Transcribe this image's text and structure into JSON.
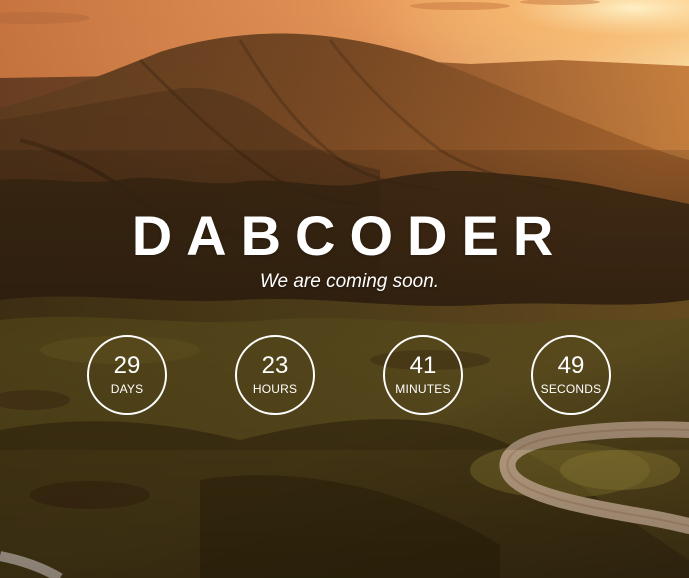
{
  "hero": {
    "brand": "DABCODER",
    "tagline": "We are coming soon."
  },
  "countdown": {
    "days": {
      "value": "29",
      "label": "DAYS"
    },
    "hours": {
      "value": "23",
      "label": "HOURS"
    },
    "minutes": {
      "value": "41",
      "label": "MINUTES"
    },
    "seconds": {
      "value": "49",
      "label": "SECONDS"
    }
  },
  "colors": {
    "text": "#ffffff",
    "sky_glow": "#f2a25a",
    "hills_dark": "#3a2812",
    "grass": "#6b5a22"
  }
}
